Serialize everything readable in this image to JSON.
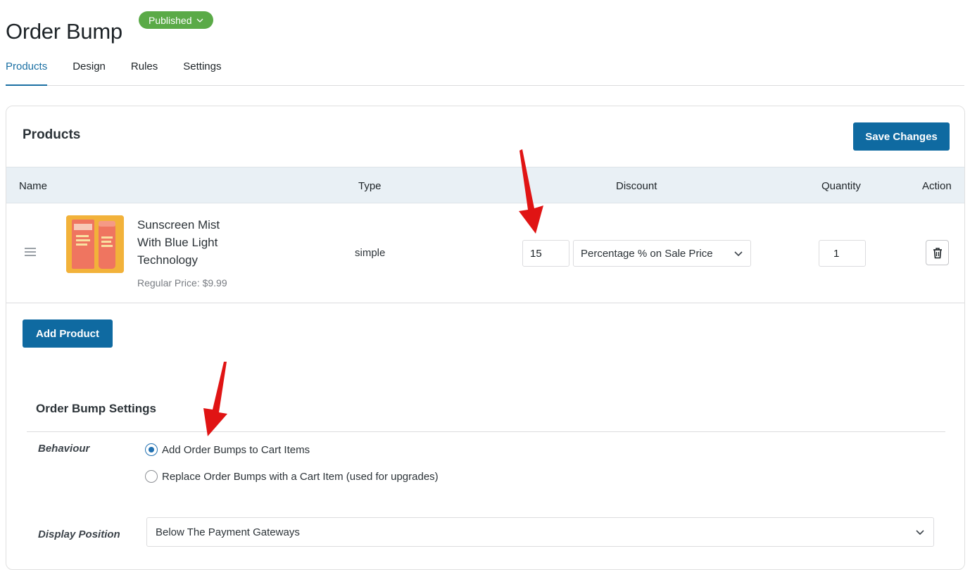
{
  "header": {
    "title": "Order Bump",
    "status": "Published"
  },
  "tabs": [
    {
      "label": "Products",
      "active": true
    },
    {
      "label": "Design",
      "active": false
    },
    {
      "label": "Rules",
      "active": false
    },
    {
      "label": "Settings",
      "active": false
    }
  ],
  "products_card": {
    "title": "Products",
    "save_label": "Save Changes",
    "columns": {
      "name": "Name",
      "type": "Type",
      "discount": "Discount",
      "quantity": "Quantity",
      "action": "Action"
    },
    "rows": [
      {
        "name": "Sunscreen Mist With Blue Light Technology",
        "price": "Regular Price: $9.99",
        "type": "simple",
        "discount_value": "15",
        "discount_type": "Percentage % on Sale Price",
        "quantity": "1"
      }
    ],
    "add_label": "Add Product"
  },
  "order_bump_settings": {
    "title": "Order Bump Settings",
    "behaviour_label": "Behaviour",
    "behaviour_options": [
      {
        "label": "Add Order Bumps to Cart Items",
        "checked": true
      },
      {
        "label": "Replace Order Bumps with a Cart Item (used for upgrades)",
        "checked": false
      }
    ],
    "display_position_label": "Display Position",
    "display_position_value": "Below The Payment Gateways"
  },
  "colors": {
    "accent": "#0f6aa1",
    "status_green": "#5aaa47",
    "annotation_red": "#e01414"
  }
}
